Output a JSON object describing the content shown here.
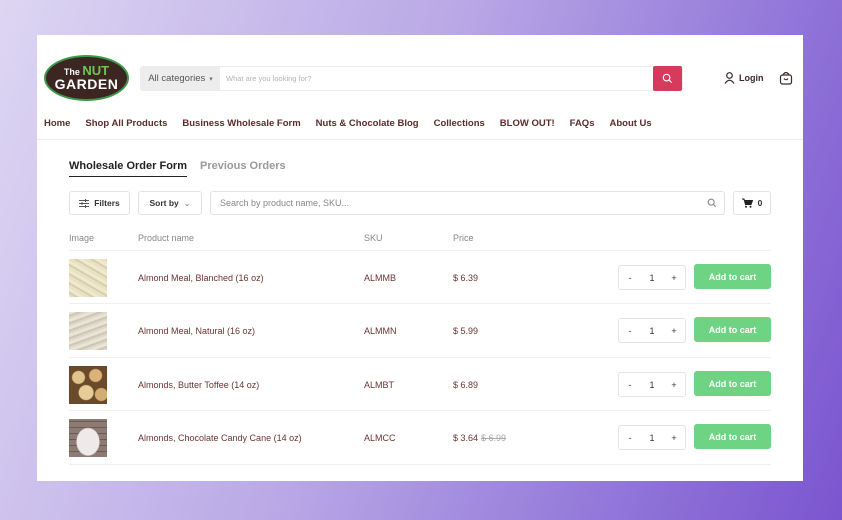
{
  "brand": {
    "logo_top": "The",
    "logo_highlight": "NUT",
    "logo_bottom": "GARDEN"
  },
  "header": {
    "category_select": "All categories",
    "search_placeholder": "What are you looking for?",
    "login_label": "Login",
    "accent_color": "#d63a5c"
  },
  "nav": [
    "Home",
    "Shop All Products",
    "Business Wholesale Form",
    "Nuts & Chocolate Blog",
    "Collections",
    "BLOW OUT!",
    "FAQs",
    "About Us"
  ],
  "tabs": {
    "active": "Wholesale Order Form",
    "inactive": "Previous Orders"
  },
  "toolbar": {
    "filters_label": "Filters",
    "sort_label": "Sort by",
    "search_placeholder": "Search by product name, SKU...",
    "cart_count": "0"
  },
  "table": {
    "headers": {
      "image": "Image",
      "name": "Product name",
      "sku": "SKU",
      "price": "Price"
    },
    "add_label": "Add to cart",
    "add_color": "#6fd384",
    "rows": [
      {
        "name": "Almond Meal, Blanched (16 oz)",
        "sku": "ALMMB",
        "price": "$ 6.39",
        "old_price": "",
        "qty": "1"
      },
      {
        "name": "Almond Meal, Natural (16 oz)",
        "sku": "ALMMN",
        "price": "$ 5.99",
        "old_price": "",
        "qty": "1"
      },
      {
        "name": "Almonds, Butter Toffee (14 oz)",
        "sku": "ALMBT",
        "price": "$ 6.89",
        "old_price": "",
        "qty": "1"
      },
      {
        "name": "Almonds, Chocolate Candy Cane (14 oz)",
        "sku": "ALMCC",
        "price": "$ 3.64",
        "old_price": "$ 6.99",
        "qty": "1"
      }
    ]
  }
}
